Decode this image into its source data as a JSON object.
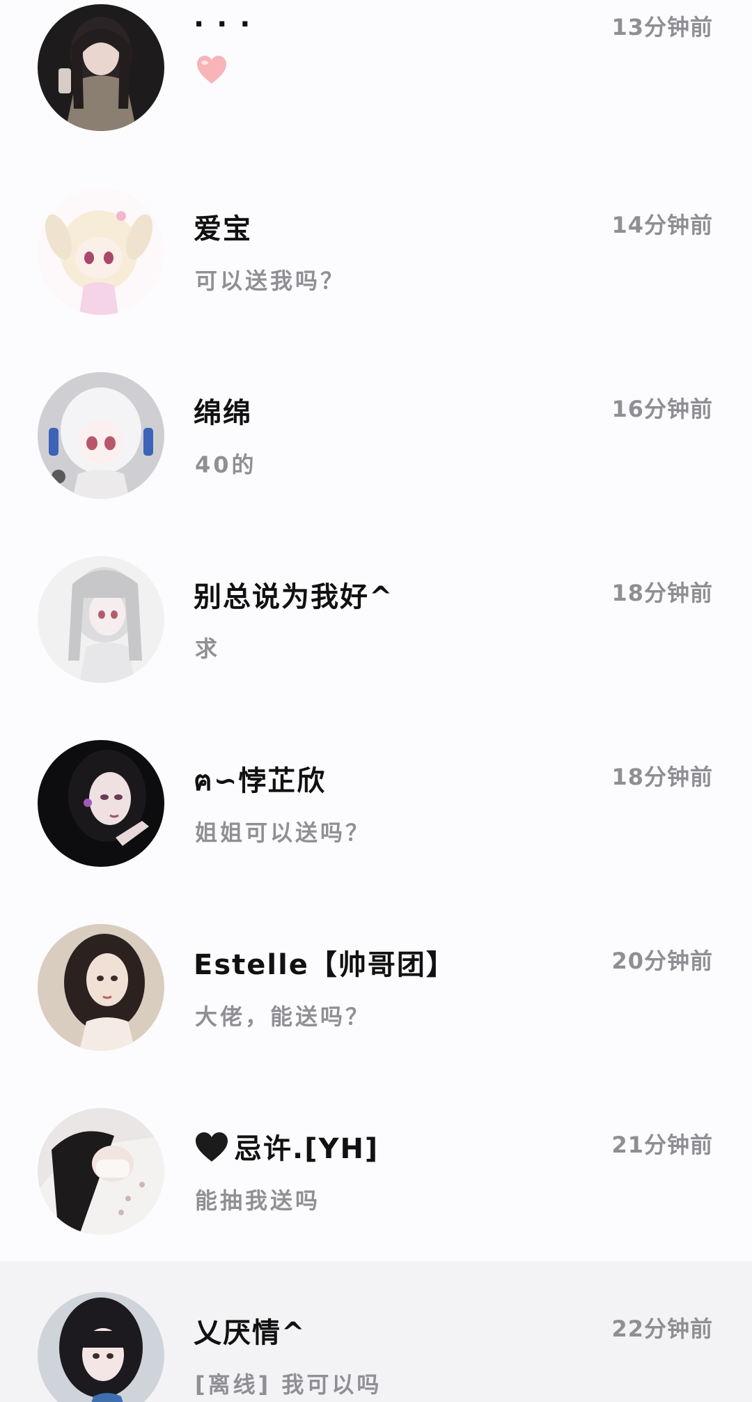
{
  "conversations": [
    {
      "name": "· · ·",
      "time": "13分钟前",
      "message": "",
      "message_icon": "pink-heart-icon",
      "avatar": "avatar-dark-hair-photo"
    },
    {
      "name": "爱宝",
      "time": "14分钟前",
      "message": "可以送我吗？",
      "avatar": "avatar-anime-bunny-girl"
    },
    {
      "name": "绵绵",
      "time": "16分钟前",
      "message": "40的",
      "avatar": "avatar-anime-white-hair"
    },
    {
      "name": "别总说为我好^",
      "time": "18分钟前",
      "message": "求",
      "avatar": "avatar-anime-grey-girl"
    },
    {
      "name": "ฅ∽悖芷欣",
      "time": "18分钟前",
      "message": "姐姐可以送吗？",
      "avatar": "avatar-dark-portrait"
    },
    {
      "name": "Estelle【帅哥团】",
      "time": "20分钟前",
      "message": "大佬，能送吗？",
      "avatar": "avatar-long-hair-portrait"
    },
    {
      "name": "忌许.[YH]",
      "name_icon": "black-heart-icon",
      "time": "21分钟前",
      "message": "能抽我送吗",
      "avatar": "avatar-lying-girl"
    },
    {
      "name": "乂厌情^",
      "time": "22分钟前",
      "message": "[离线] 我可以吗",
      "avatar": "avatar-bangs-girl",
      "highlighted": true
    }
  ],
  "colors": {
    "background": "#fcfbfd",
    "highlight_row": "#f3f2f5",
    "name_text": "#111111",
    "secondary_text": "#8e8e93",
    "heart_pink": "#f7b5b8"
  }
}
